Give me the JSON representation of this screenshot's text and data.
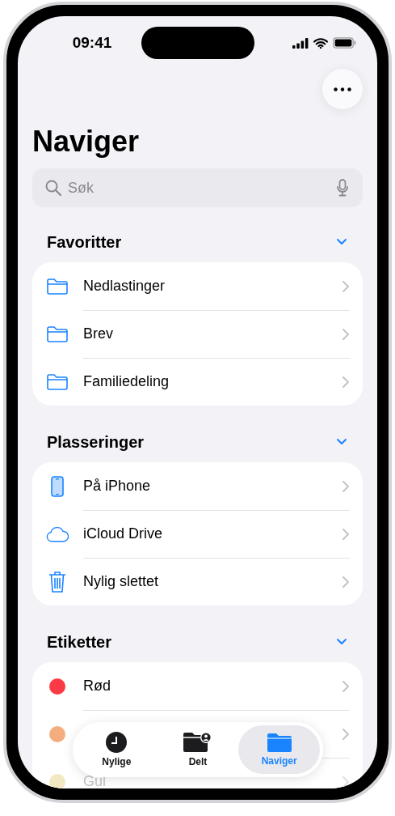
{
  "status_bar": {
    "time": "09:41"
  },
  "title": "Naviger",
  "search": {
    "placeholder": "Søk"
  },
  "sections": [
    {
      "title": "Favoritter",
      "expanded": true,
      "items": [
        {
          "kind": "folder",
          "label": "Nedlastinger"
        },
        {
          "kind": "folder",
          "label": "Brev"
        },
        {
          "kind": "folder",
          "label": "Familiedeling"
        }
      ]
    },
    {
      "title": "Plasseringer",
      "expanded": true,
      "items": [
        {
          "kind": "phone",
          "label": "På iPhone"
        },
        {
          "kind": "cloud",
          "label": "iCloud Drive"
        },
        {
          "kind": "trash",
          "label": "Nylig slettet"
        }
      ]
    },
    {
      "title": "Etiketter",
      "expanded": true,
      "items": [
        {
          "kind": "tag",
          "label": "Rød",
          "color": "#fa3a44",
          "dimmed": false
        },
        {
          "kind": "tag",
          "color": "#f4ae7e",
          "dimmed": false
        },
        {
          "kind": "tag",
          "label": "Gul",
          "color": "#f2e8c2",
          "dimmed": true
        }
      ]
    }
  ],
  "tab_bar": [
    {
      "kind": "clock",
      "label": "Nylige",
      "selected": false
    },
    {
      "kind": "shared",
      "label": "Delt",
      "selected": false
    },
    {
      "kind": "folder",
      "label": "Naviger",
      "selected": true
    }
  ]
}
